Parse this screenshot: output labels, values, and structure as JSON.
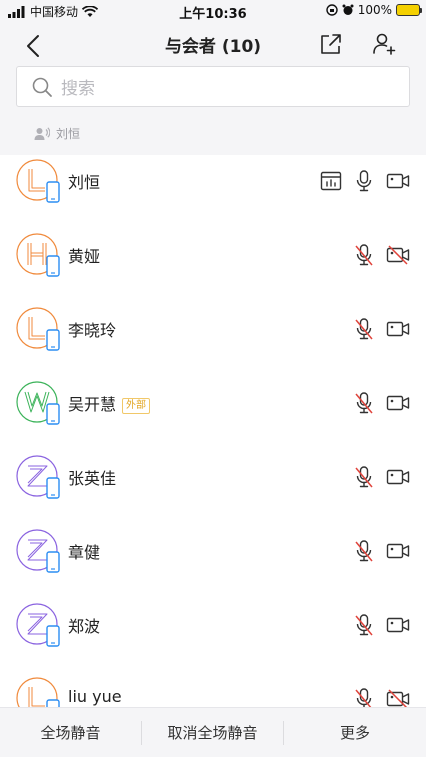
{
  "status_bar": {
    "carrier": "中国移动",
    "time": "上午10:36",
    "battery": "100%"
  },
  "nav": {
    "title": "与会者 (10)"
  },
  "search": {
    "placeholder": "搜索"
  },
  "speaker": {
    "name": "刘恒"
  },
  "participants": [
    {
      "name": "刘恒",
      "initial": "L",
      "color": "#f08a3c",
      "tag": "",
      "mic_muted": false,
      "camera_off": false,
      "presenting": true
    },
    {
      "name": "黄娅",
      "initial": "H",
      "color": "#f08a3c",
      "tag": "",
      "mic_muted": true,
      "camera_off": true,
      "presenting": false
    },
    {
      "name": "李晓玲",
      "initial": "L",
      "color": "#f08a3c",
      "tag": "",
      "mic_muted": true,
      "camera_off": false,
      "presenting": false
    },
    {
      "name": "吴开慧",
      "initial": "W",
      "color": "#3cb35a",
      "tag": "外部",
      "mic_muted": true,
      "camera_off": false,
      "presenting": false
    },
    {
      "name": "张英佳",
      "initial": "Z",
      "color": "#8a63e0",
      "tag": "",
      "mic_muted": true,
      "camera_off": false,
      "presenting": false
    },
    {
      "name": "章健",
      "initial": "Z",
      "color": "#8a63e0",
      "tag": "",
      "mic_muted": true,
      "camera_off": false,
      "presenting": false
    },
    {
      "name": "郑波",
      "initial": "Z",
      "color": "#8a63e0",
      "tag": "",
      "mic_muted": true,
      "camera_off": false,
      "presenting": false
    },
    {
      "name": "liu yue",
      "initial": "L",
      "color": "#f08a3c",
      "tag": "",
      "mic_muted": true,
      "camera_off": true,
      "presenting": false
    }
  ],
  "bottom_bar": {
    "mute_all": "全场静音",
    "unmute_all": "取消全场静音",
    "more": "更多"
  },
  "colors": {
    "mic_muted": "#e0433b",
    "icon": "#333333",
    "phone_badge": "#2c8df2"
  }
}
